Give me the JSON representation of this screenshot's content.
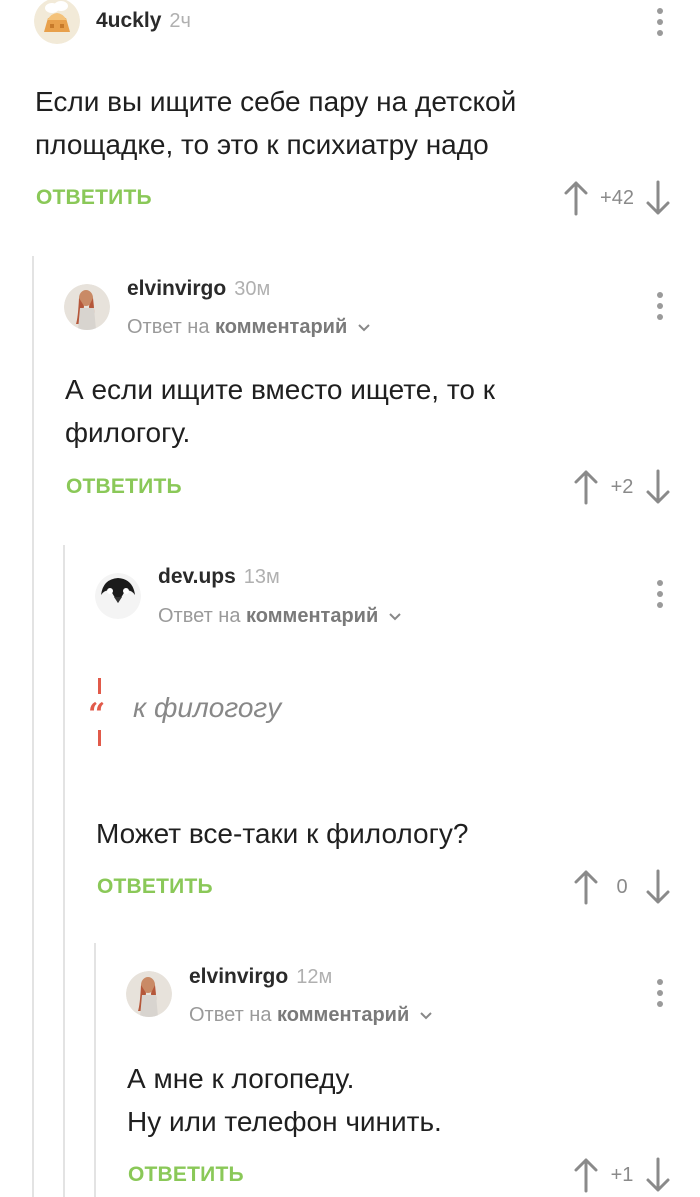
{
  "comments": [
    {
      "author": "4uckly",
      "time": "2ч",
      "reply_to": null,
      "lines": [
        "Если вы ищите себе пару на детской",
        "площадке, то это к психиатру надо"
      ],
      "reply_label": "ОТВЕТИТЬ",
      "score": "+42"
    },
    {
      "author": "elvinvirgo",
      "time": "30м",
      "reply_to": {
        "prefix": "Ответ на",
        "target": "комментарий"
      },
      "lines": [
        "А если ищите вместо ищете, то к",
        "филогогу."
      ],
      "reply_label": "ОТВЕТИТЬ",
      "score": "+2"
    },
    {
      "author": "dev.ups",
      "time": "13м",
      "reply_to": {
        "prefix": "Ответ на",
        "target": "комментарий"
      },
      "quote": "к филогогу",
      "lines": [
        "Может все-таки к филологу?"
      ],
      "reply_label": "ОТВЕТИТЬ",
      "score": "0"
    },
    {
      "author": "elvinvirgo",
      "time": "12м",
      "reply_to": {
        "prefix": "Ответ на",
        "target": "комментарий"
      },
      "lines": [
        "А мне к логопеду.",
        "Ну или телефон чинить."
      ],
      "reply_label": "ОТВЕТИТЬ",
      "score": "+1"
    }
  ],
  "icons": {
    "upvote": "arrow-up-icon",
    "downvote": "arrow-down-icon",
    "more": "more-vertical-icon",
    "chevron": "chevron-down-icon"
  },
  "colors": {
    "accent": "#8ac858",
    "quote": "#e15a4a"
  }
}
